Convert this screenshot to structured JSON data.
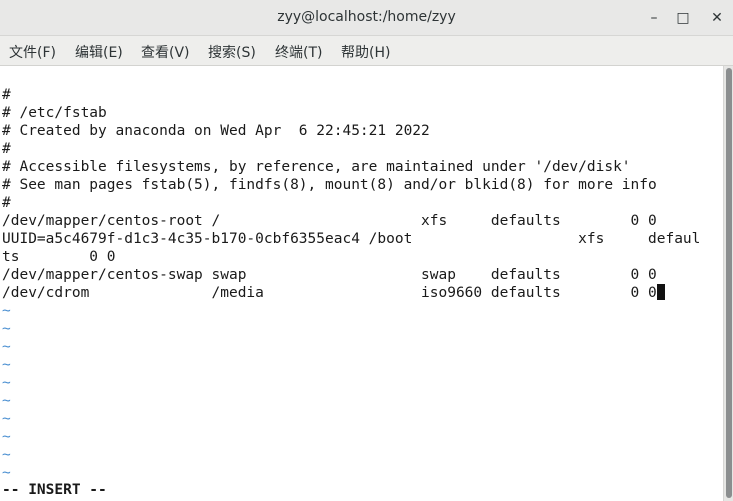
{
  "window": {
    "title": "zyy@localhost:/home/zyy",
    "minimize_glyph": "–",
    "maximize_glyph": "□",
    "close_glyph": "✕"
  },
  "menu": {
    "file": "文件(F)",
    "edit": "编辑(E)",
    "view": "查看(V)",
    "search": "搜索(S)",
    "terminal": "终端(T)",
    "help": "帮助(H)"
  },
  "terminal": {
    "lines": [
      "",
      "#",
      "# /etc/fstab",
      "# Created by anaconda on Wed Apr  6 22:45:21 2022",
      "#",
      "# Accessible filesystems, by reference, are maintained under '/dev/disk'",
      "# See man pages fstab(5), findfs(8), mount(8) and/or blkid(8) for more info",
      "#",
      "/dev/mapper/centos-root /                       xfs     defaults        0 0",
      "UUID=a5c4679f-d1c3-4c35-b170-0cbf6355eac4 /boot                   xfs     defaul",
      "ts        0 0",
      "/dev/mapper/centos-swap swap                    swap    defaults        0 0",
      "/dev/cdrom              /media                  iso9660 defaults        0 0"
    ],
    "tilde_lines": [
      "~",
      "~",
      "~",
      "~",
      "~",
      "~",
      "~",
      "~",
      "~",
      "~"
    ],
    "mode": "-- INSERT --"
  },
  "colors": {
    "tilde": "#4a8fd1",
    "background": "#ffffff",
    "text": "#1a1a1a"
  }
}
